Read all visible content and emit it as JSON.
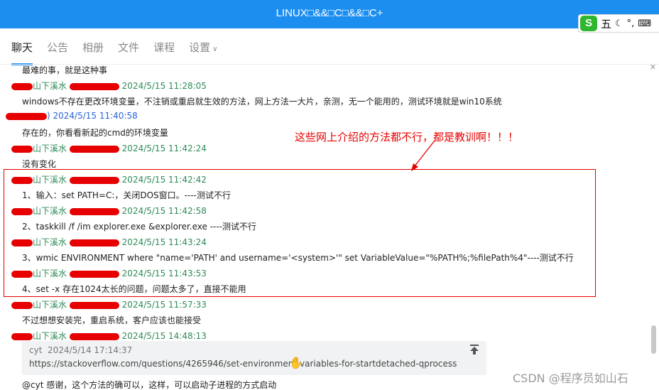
{
  "window": {
    "title": "LINUX□&&□C□&&□C+"
  },
  "ime": {
    "logo": "S",
    "mode": "五",
    "moon": "☾",
    "dot": "°,",
    "keyboard": "⌨"
  },
  "tabs": [
    {
      "label": "聊天",
      "active": true
    },
    {
      "label": "公告"
    },
    {
      "label": "相册"
    },
    {
      "label": "文件"
    },
    {
      "label": "课程"
    },
    {
      "label": "设置",
      "caret": "∨"
    }
  ],
  "collapse_icon": "✕",
  "messages": [
    {
      "text": "最难的事，就是这种事"
    },
    {
      "sender": "山下溪水",
      "time": "2024/5/15 11:28:05",
      "text": "windows不存在更改环境变量，不注销或重启就生效的方法，网上方法一大片，亲测，无一个能用的，测试环境就是win10系统"
    },
    {
      "sender": ")",
      "time": "2024/5/15 11:40:58",
      "text": "存在的，你看看新起的cmd的环境变量"
    },
    {
      "sender": "山下溪水",
      "time": "2024/5/15 11:42:24",
      "text": "没有变化"
    },
    {
      "sender": "山下溪水",
      "time": "2024/5/15 11:42:42",
      "text": "1、输入：set PATH=C:，关闭DOS窗口。----测试不行"
    },
    {
      "sender": "山下溪水",
      "time": "2024/5/15 11:42:58",
      "text": "2、taskkill /f /im explorer.exe &explorer.exe ----测试不行"
    },
    {
      "sender": "山下溪水",
      "time": "2024/5/15 11:43:24",
      "text": "3、wmic ENVIRONMENT where \"name='PATH' and username='<system>'\" set VariableValue=\"%PATH%;%filePath%4\"----测试不行"
    },
    {
      "sender": "山下溪水",
      "time": "2024/5/15 11:43:53",
      "text": "4、set -x 存在1024太长的问题，问题太多了，直接不能用"
    },
    {
      "sender": "山下溪水",
      "time": "2024/5/15 11:57:33",
      "text": "不过想想安装完，重启系统，客户应该也能接受"
    },
    {
      "sender": "山下溪水",
      "time": "2024/5/15 14:48:13"
    }
  ],
  "annotation": "这些网上介绍的方法都不行，都是教训啊！！！",
  "quote": {
    "author": "cyt",
    "time": "2024/5/14 17:14:37",
    "url": "https://stackoverflow.com/questions/4265946/set-environment-variables-for-startdetached-qprocess"
  },
  "last_message": "@cyt 感谢，这个方法的确可以，这样，可以启动子进程的方式启动",
  "watermark": "CSDN @程序员如山石",
  "colors": {
    "titlebar": "#1b8ef0",
    "sender": "#2e8b57",
    "sender_alt": "#2a62d6",
    "annotation": "#e60000"
  }
}
